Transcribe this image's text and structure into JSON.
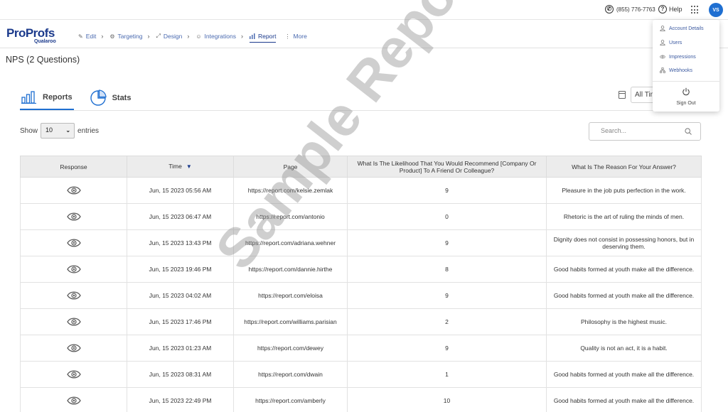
{
  "topbar": {
    "phone": "(855) 776-7763",
    "help": "Help",
    "avatar": "VS"
  },
  "brand": {
    "logo_pro": "Pro",
    "logo_profs": "Profs",
    "logo_sub": "Qualaroo"
  },
  "nav": {
    "items": [
      {
        "label": "Edit",
        "icon": "pencil-icon"
      },
      {
        "label": "Targeting",
        "icon": "gear-icon"
      },
      {
        "label": "Design",
        "icon": "design-icon"
      },
      {
        "label": "Integrations",
        "icon": "integrations-icon"
      },
      {
        "label": "Report",
        "icon": "bar-chart-icon"
      },
      {
        "label": "More",
        "icon": "more-icon"
      }
    ]
  },
  "page": {
    "title": "NPS (2 Questions)"
  },
  "tabs": [
    {
      "label": "Reports",
      "icon": "bar-chart-icon",
      "active": true
    },
    {
      "label": "Stats",
      "icon": "pie-chart-icon",
      "active": false
    }
  ],
  "filter": {
    "time_value": "All Time"
  },
  "entries": {
    "show": "Show",
    "value": "10",
    "suffix": "entries"
  },
  "search": {
    "placeholder": "Search..."
  },
  "table": {
    "headers": [
      "Response",
      "Time",
      "Page",
      "What Is The Likelihood That You Would Recommend [Company Or Product] To A Friend Or Colleague?",
      "What Is The Reason For Your Answer?"
    ],
    "rows": [
      {
        "time": "Jun, 15 2023 05:56 AM",
        "page": "https://report.com/kelsie.zemlak",
        "score": "9",
        "reason": "Pleasure in the job puts perfection in the work."
      },
      {
        "time": "Jun, 15 2023 06:47 AM",
        "page": "https://report.com/antonio",
        "score": "0",
        "reason": "Rhetoric is the art of ruling the minds of men."
      },
      {
        "time": "Jun, 15 2023 13:43 PM",
        "page": "https://report.com/adriana.wehner",
        "score": "9",
        "reason": "Dignity does not consist in possessing honors, but in deserving them."
      },
      {
        "time": "Jun, 15 2023 19:46 PM",
        "page": "https://report.com/dannie.hirthe",
        "score": "8",
        "reason": "Good habits formed at youth make all the difference."
      },
      {
        "time": "Jun, 15 2023 04:02 AM",
        "page": "https://report.com/eloisa",
        "score": "9",
        "reason": "Good habits formed at youth make all the difference."
      },
      {
        "time": "Jun, 15 2023 17:46 PM",
        "page": "https://report.com/williams.parisian",
        "score": "2",
        "reason": "Philosophy is the highest music."
      },
      {
        "time": "Jun, 15 2023 01:23 AM",
        "page": "https://report.com/dewey",
        "score": "9",
        "reason": "Quality is not an act, it is a habit."
      },
      {
        "time": "Jun, 15 2023 08:31 AM",
        "page": "https://report.com/dwain",
        "score": "1",
        "reason": "Good habits formed at youth make all the difference."
      },
      {
        "time": "Jun, 15 2023 22:49 PM",
        "page": "https://report.com/amberly",
        "score": "10",
        "reason": "Good habits formed at youth make all the difference."
      }
    ]
  },
  "watermark": "Sample Report",
  "account_menu": {
    "items": [
      {
        "label": "Account Details",
        "icon": "user-icon"
      },
      {
        "label": "Users",
        "icon": "users-icon"
      },
      {
        "label": "Impressions",
        "icon": "eye-icon"
      },
      {
        "label": "Webhooks",
        "icon": "webhooks-icon"
      }
    ],
    "sign_out": "Sign Out"
  },
  "colors": {
    "brand": "#1b3a8c",
    "accent": "#1f6fd1",
    "header_bg": "#ececec"
  }
}
